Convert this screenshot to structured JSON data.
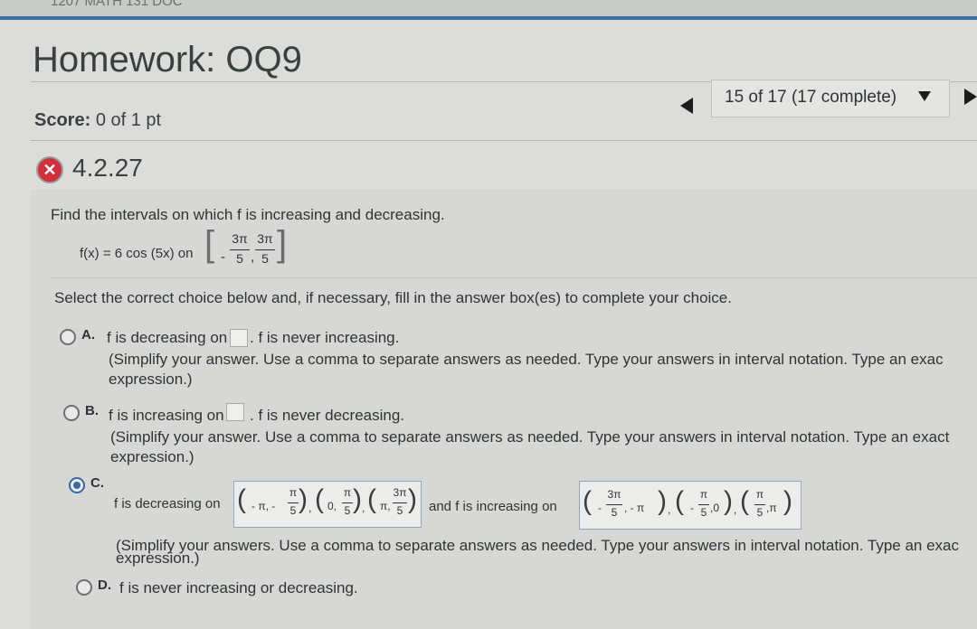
{
  "top_strip_text": "1207 MATH 131 DOC",
  "title": "Homework: OQ9",
  "score": {
    "label": "Score:",
    "value": "0 of 1 pt"
  },
  "navigation": {
    "progress": "15 of 17 (17 complete)"
  },
  "question": {
    "number": "4.2.27",
    "prompt": "Find the intervals on which f is increasing and decreasing.",
    "function": "f(x) = 6 cos (5x) on",
    "interval": {
      "left": "3π",
      "right": "3π",
      "den": "5",
      "minus": "-",
      "comma": ","
    },
    "instruction": "Select the correct choice below and, if necessary, fill in the answer box(es) to complete your choice."
  },
  "choices": {
    "a": {
      "letter": "A.",
      "pre": "f is decreasing on",
      "post": ". f is never increasing.",
      "note1": "(Simplify your answer. Use a comma to separate answers as needed. Type your answers in interval notation. Type an exac",
      "note2": "expression.)"
    },
    "b": {
      "letter": "B.",
      "pre": "f is increasing on",
      "post": ". f is never decreasing.",
      "note1": "(Simplify your answer. Use a comma to separate answers as needed. Type your answers in interval notation. Type an exact",
      "note2": "expression.)"
    },
    "c": {
      "letter": "C.",
      "pre": "f is decreasing on",
      "mid": "and f is increasing on",
      "dec_answer": {
        "i1_left": "- π, -",
        "i1_num": "π",
        "i1_den": "5",
        "i2_left": "0,",
        "i2_num": "π",
        "i2_den": "5",
        "i3_left": "π,",
        "i3_num": "3π",
        "i3_den": "5",
        "sep": ","
      },
      "inc_answer": {
        "i1_num": "3π",
        "i1_den": "5",
        "i1_right": ", - π",
        "i1_minus": "-",
        "i2_num": "π",
        "i2_den": "5",
        "i2_right": ",0",
        "i2_minus": "-",
        "i3_num": "π",
        "i3_den": "5",
        "i3_right": ",π",
        "sep": ","
      },
      "note1": "(Simplify your answers. Use a comma to separate answers as needed. Type your answers in interval notation. Type an exac",
      "note2": "expression.)"
    },
    "d": {
      "letter": "D.",
      "text": "f is never increasing or decreasing."
    }
  },
  "colors": {
    "selected": "#3a6aa6",
    "wrong": "#d0303a",
    "header_line": "#3d6f9c"
  }
}
